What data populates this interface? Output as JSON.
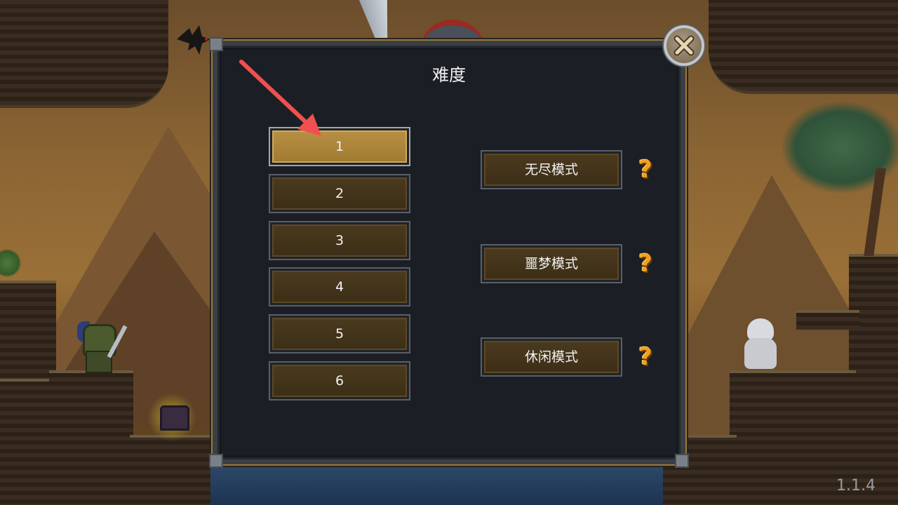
{
  "dialog": {
    "title": "难度",
    "difficulty_levels": [
      {
        "label": "1",
        "selected": true
      },
      {
        "label": "2",
        "selected": false
      },
      {
        "label": "3",
        "selected": false
      },
      {
        "label": "4",
        "selected": false
      },
      {
        "label": "5",
        "selected": false
      },
      {
        "label": "6",
        "selected": false
      }
    ],
    "modes": [
      {
        "label": "无尽模式",
        "help": "?"
      },
      {
        "label": "噩梦模式",
        "help": "?"
      },
      {
        "label": "休闲模式",
        "help": "?"
      }
    ]
  },
  "version": "1.1.4",
  "colors": {
    "panel_bg": "#1b1f25",
    "button_bg": "#3c2e17",
    "button_selected_bg": "#a07a32",
    "help_icon": "#f0a020",
    "arrow": "#f05050"
  },
  "icons": {
    "close": "close-icon",
    "help": "question-mark-icon",
    "pointer": "arrow-annotation"
  }
}
